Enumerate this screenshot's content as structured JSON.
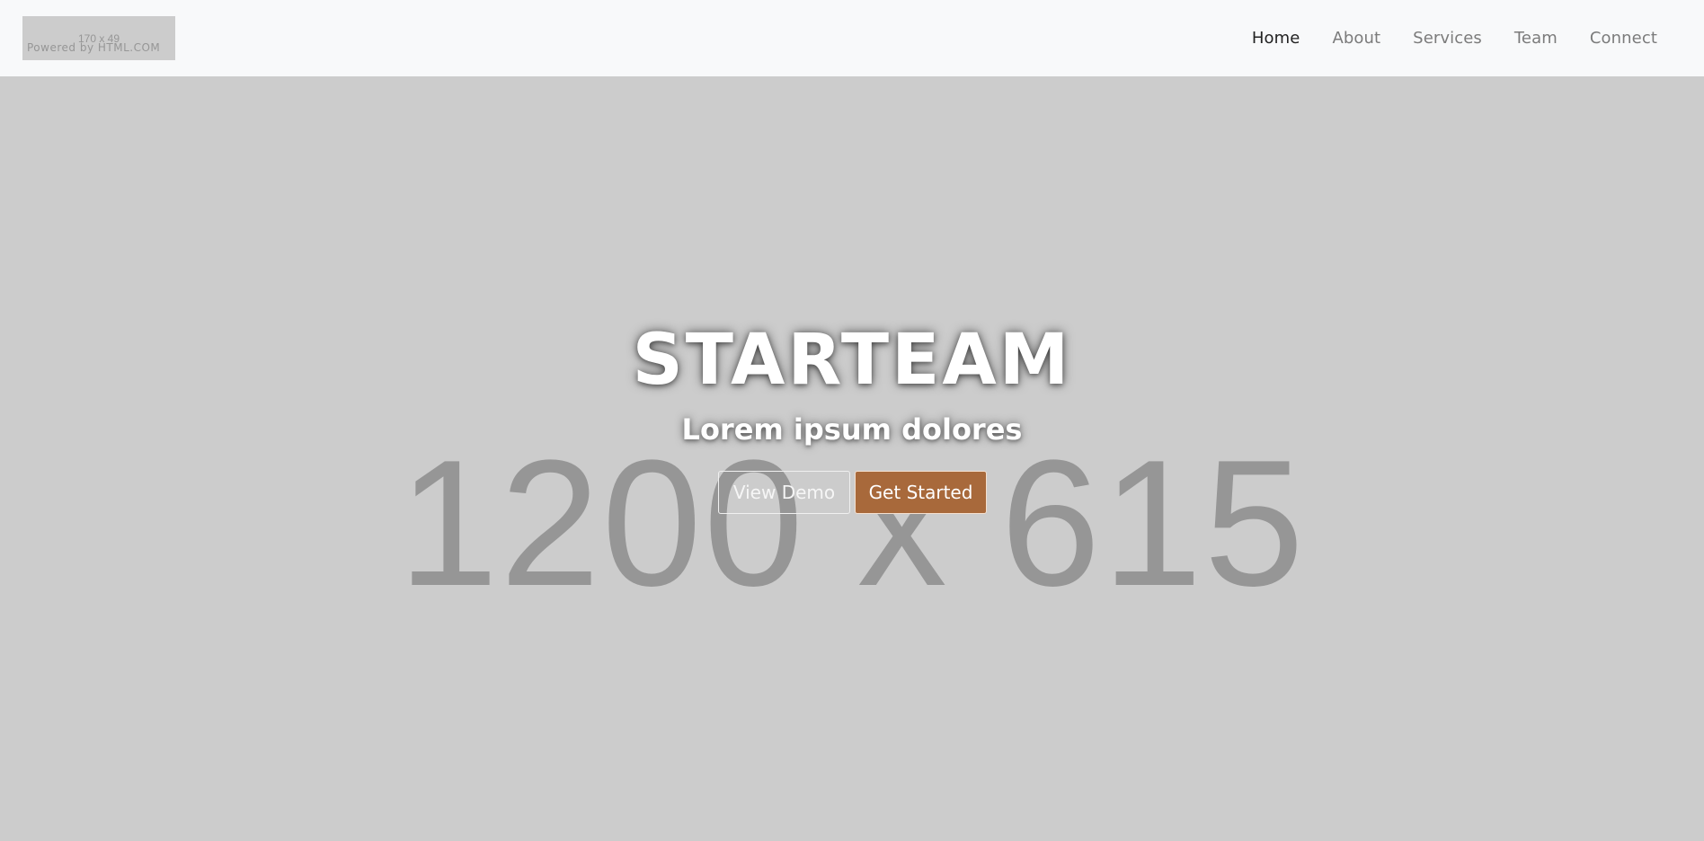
{
  "navbar": {
    "brand": {
      "placeholder_text": "170 x 49",
      "powered_by": "Powered by HTML.COM"
    },
    "links": [
      {
        "label": "Home",
        "active": true
      },
      {
        "label": "About",
        "active": false
      },
      {
        "label": "Services",
        "active": false
      },
      {
        "label": "Team",
        "active": false
      },
      {
        "label": "Connect",
        "active": false
      }
    ]
  },
  "hero": {
    "placeholder_text": "1200 x 615",
    "title": "STARTEAM",
    "subtitle": "Lorem ipsum dolores",
    "buttons": {
      "demo_label": "View Demo",
      "start_label": "Get Started"
    }
  },
  "colors": {
    "navbar_bg": "#f8f9fa",
    "hero_bg": "#cccccc",
    "accent": "#a8693b",
    "nav_active": "#222222",
    "nav_inactive": "#7b7b7b"
  }
}
